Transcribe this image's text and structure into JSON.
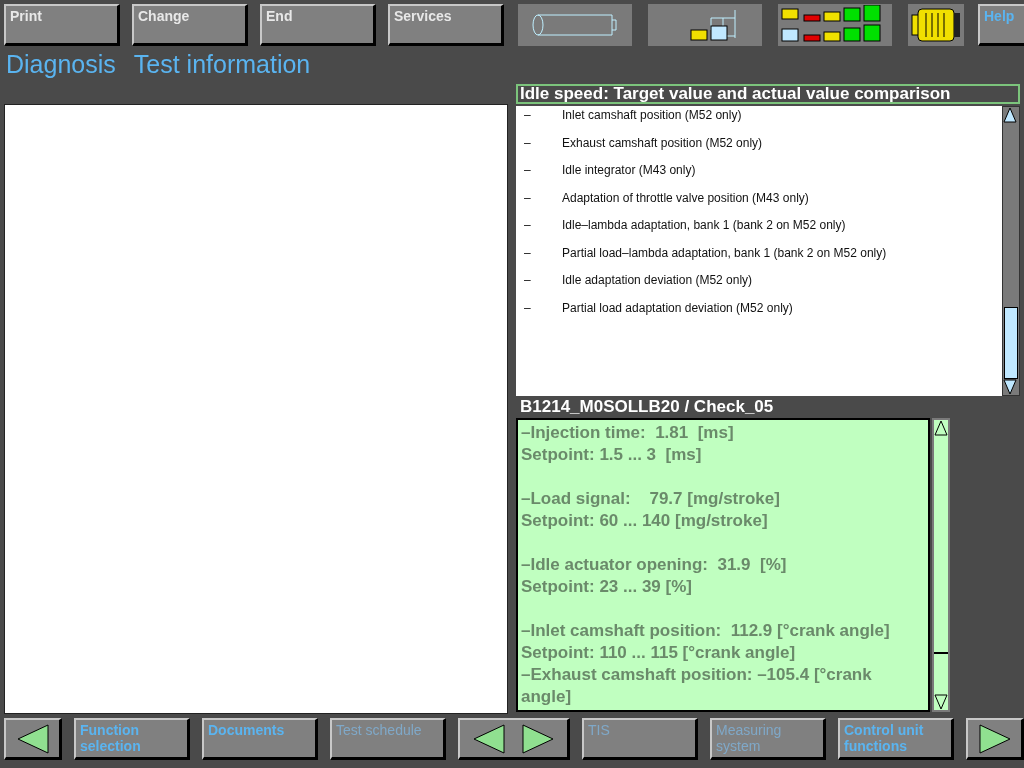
{
  "toolbar": {
    "buttons": [
      {
        "kind": "text",
        "label": "Print"
      },
      {
        "kind": "text",
        "label": "Change"
      },
      {
        "kind": "text",
        "label": "End"
      },
      {
        "kind": "text",
        "label": "Services"
      },
      {
        "kind": "cylinder"
      },
      {
        "kind": "network"
      },
      {
        "kind": "signal"
      },
      {
        "kind": "connector"
      },
      {
        "kind": "help",
        "label": "Help"
      }
    ]
  },
  "breadcrumb": [
    "Diagnosis",
    "Test information"
  ],
  "test_list": {
    "title": "Idle speed: Target value and actual value comparison",
    "items": [
      {
        "bullet": "–",
        "text": "Inlet camshaft position (M52 only)"
      },
      {
        "bullet": "–",
        "text": "Exhaust camshaft position (M52 only)"
      },
      {
        "bullet": "–",
        "text": "Idle integrator (M43 only)"
      },
      {
        "bullet": "–",
        "text": "Adaptation of throttle valve position (M43 only)"
      },
      {
        "bullet": "–",
        "text": "Idle–lambda adaptation, bank 1 (bank 2 on M52 only)"
      },
      {
        "bullet": "–",
        "text": "Partial load–lambda adaptation, bank 1 (bank 2 on M52 only)"
      },
      {
        "bullet": "–",
        "text": "Idle adaptation deviation (M52 only)"
      },
      {
        "bullet": "–",
        "text": "Partial load adaptation deviation (M52 only)"
      }
    ]
  },
  "result": {
    "title": "B1214_M0SOLLB20 / Check_05",
    "paragraphs": [
      [
        "–Injection time:  1.81  [ms]",
        "Setpoint: 1.5 ... 3  [ms]"
      ],
      [
        "–Load signal:    79.7 [mg/stroke]",
        "Setpoint: 60 ... 140 [mg/stroke]"
      ],
      [
        "–Idle actuator opening:  31.9  [%]",
        "Setpoint: 23 ... 39 [%]"
      ],
      [
        "–Inlet camshaft position:  112.9 [°crank angle]",
        "Setpoint: 110 ... 115 [°crank angle]",
        "–Exhaust camshaft position: –105.4 [°crank angle]"
      ]
    ]
  },
  "nav": [
    {
      "kind": "back"
    },
    {
      "kind": "button",
      "label": "Function selection",
      "disabled": false
    },
    {
      "kind": "button",
      "label": "Documents",
      "disabled": false
    },
    {
      "kind": "button",
      "label": "Test schedule",
      "disabled": true
    },
    {
      "kind": "pair"
    },
    {
      "kind": "button",
      "label": "TIS",
      "disabled": true
    },
    {
      "kind": "button",
      "label": "Measuring system",
      "disabled": true
    },
    {
      "kind": "button",
      "label": "Control unit functions",
      "disabled": false
    },
    {
      "kind": "forward"
    }
  ]
}
